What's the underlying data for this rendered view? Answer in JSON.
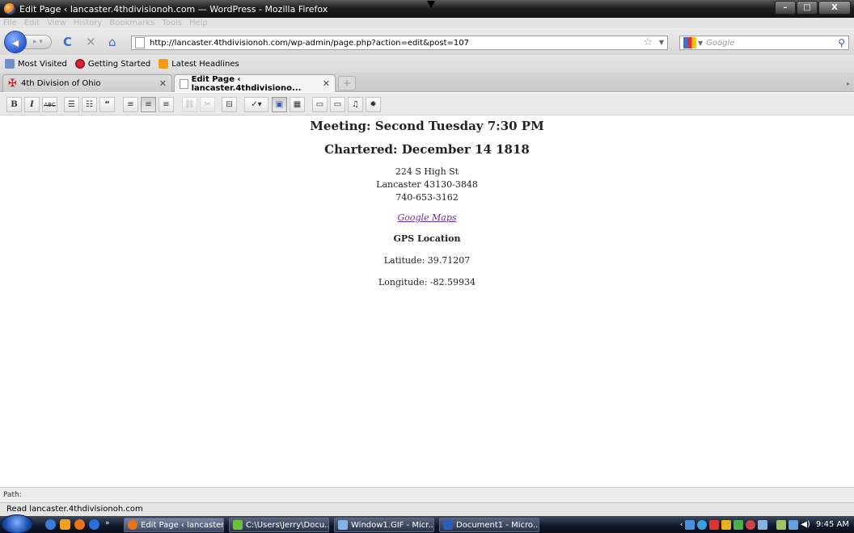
{
  "window": {
    "title": "Edit Page ‹ lancaster.4thdivisionoh.com — WordPress - Mozilla Firefox",
    "min_label": "–",
    "max_label": "□",
    "close_label": "X"
  },
  "menubar": {
    "items": [
      "File",
      "Edit",
      "View",
      "History",
      "Bookmarks",
      "Tools",
      "Help"
    ]
  },
  "navbar": {
    "url": "http://lancaster.4thdivisionoh.com/wp-admin/page.php?action=edit&post=107",
    "search_placeholder": "Google"
  },
  "bookmarks": {
    "items": [
      "Most Visited",
      "Getting Started",
      "Latest Headlines"
    ]
  },
  "tabs": [
    {
      "label": "4th Division of Ohio",
      "active": false
    },
    {
      "label": "Edit Page ‹ lancaster.4thdivisiono...",
      "active": true
    }
  ],
  "editor_toolbar": {
    "bold": "B",
    "italic": "I",
    "strike": "ABC",
    "blockquote": "“"
  },
  "content": {
    "meeting": "Meeting: Second Tuesday 7:30 PM",
    "chartered": "Chartered: December 14 1818",
    "address_line1": "224 S High St",
    "address_line2": "Lancaster 43130-3848",
    "phone": "740-653-3162",
    "maps_link": "Google Maps",
    "gps_heading": "GPS Location",
    "latitude": "Latitude: 39.71207",
    "longitude": "Longitude: -82.59934"
  },
  "pathbar": {
    "label": "Path:"
  },
  "statusbar": {
    "text": "Read lancaster.4thdivisionoh.com"
  },
  "taskbar": {
    "buttons": [
      "Edit Page ‹ lancaster...",
      "C:\\Users\\Jerry\\Docu...",
      "Window1.GIF - Micr...",
      "Document1 - Micro..."
    ],
    "clock": "9:45 AM"
  },
  "colors": {
    "link_visited": "#6b2a8a",
    "titlebar": "#1f1f1f",
    "taskbar": "#0f1728"
  }
}
